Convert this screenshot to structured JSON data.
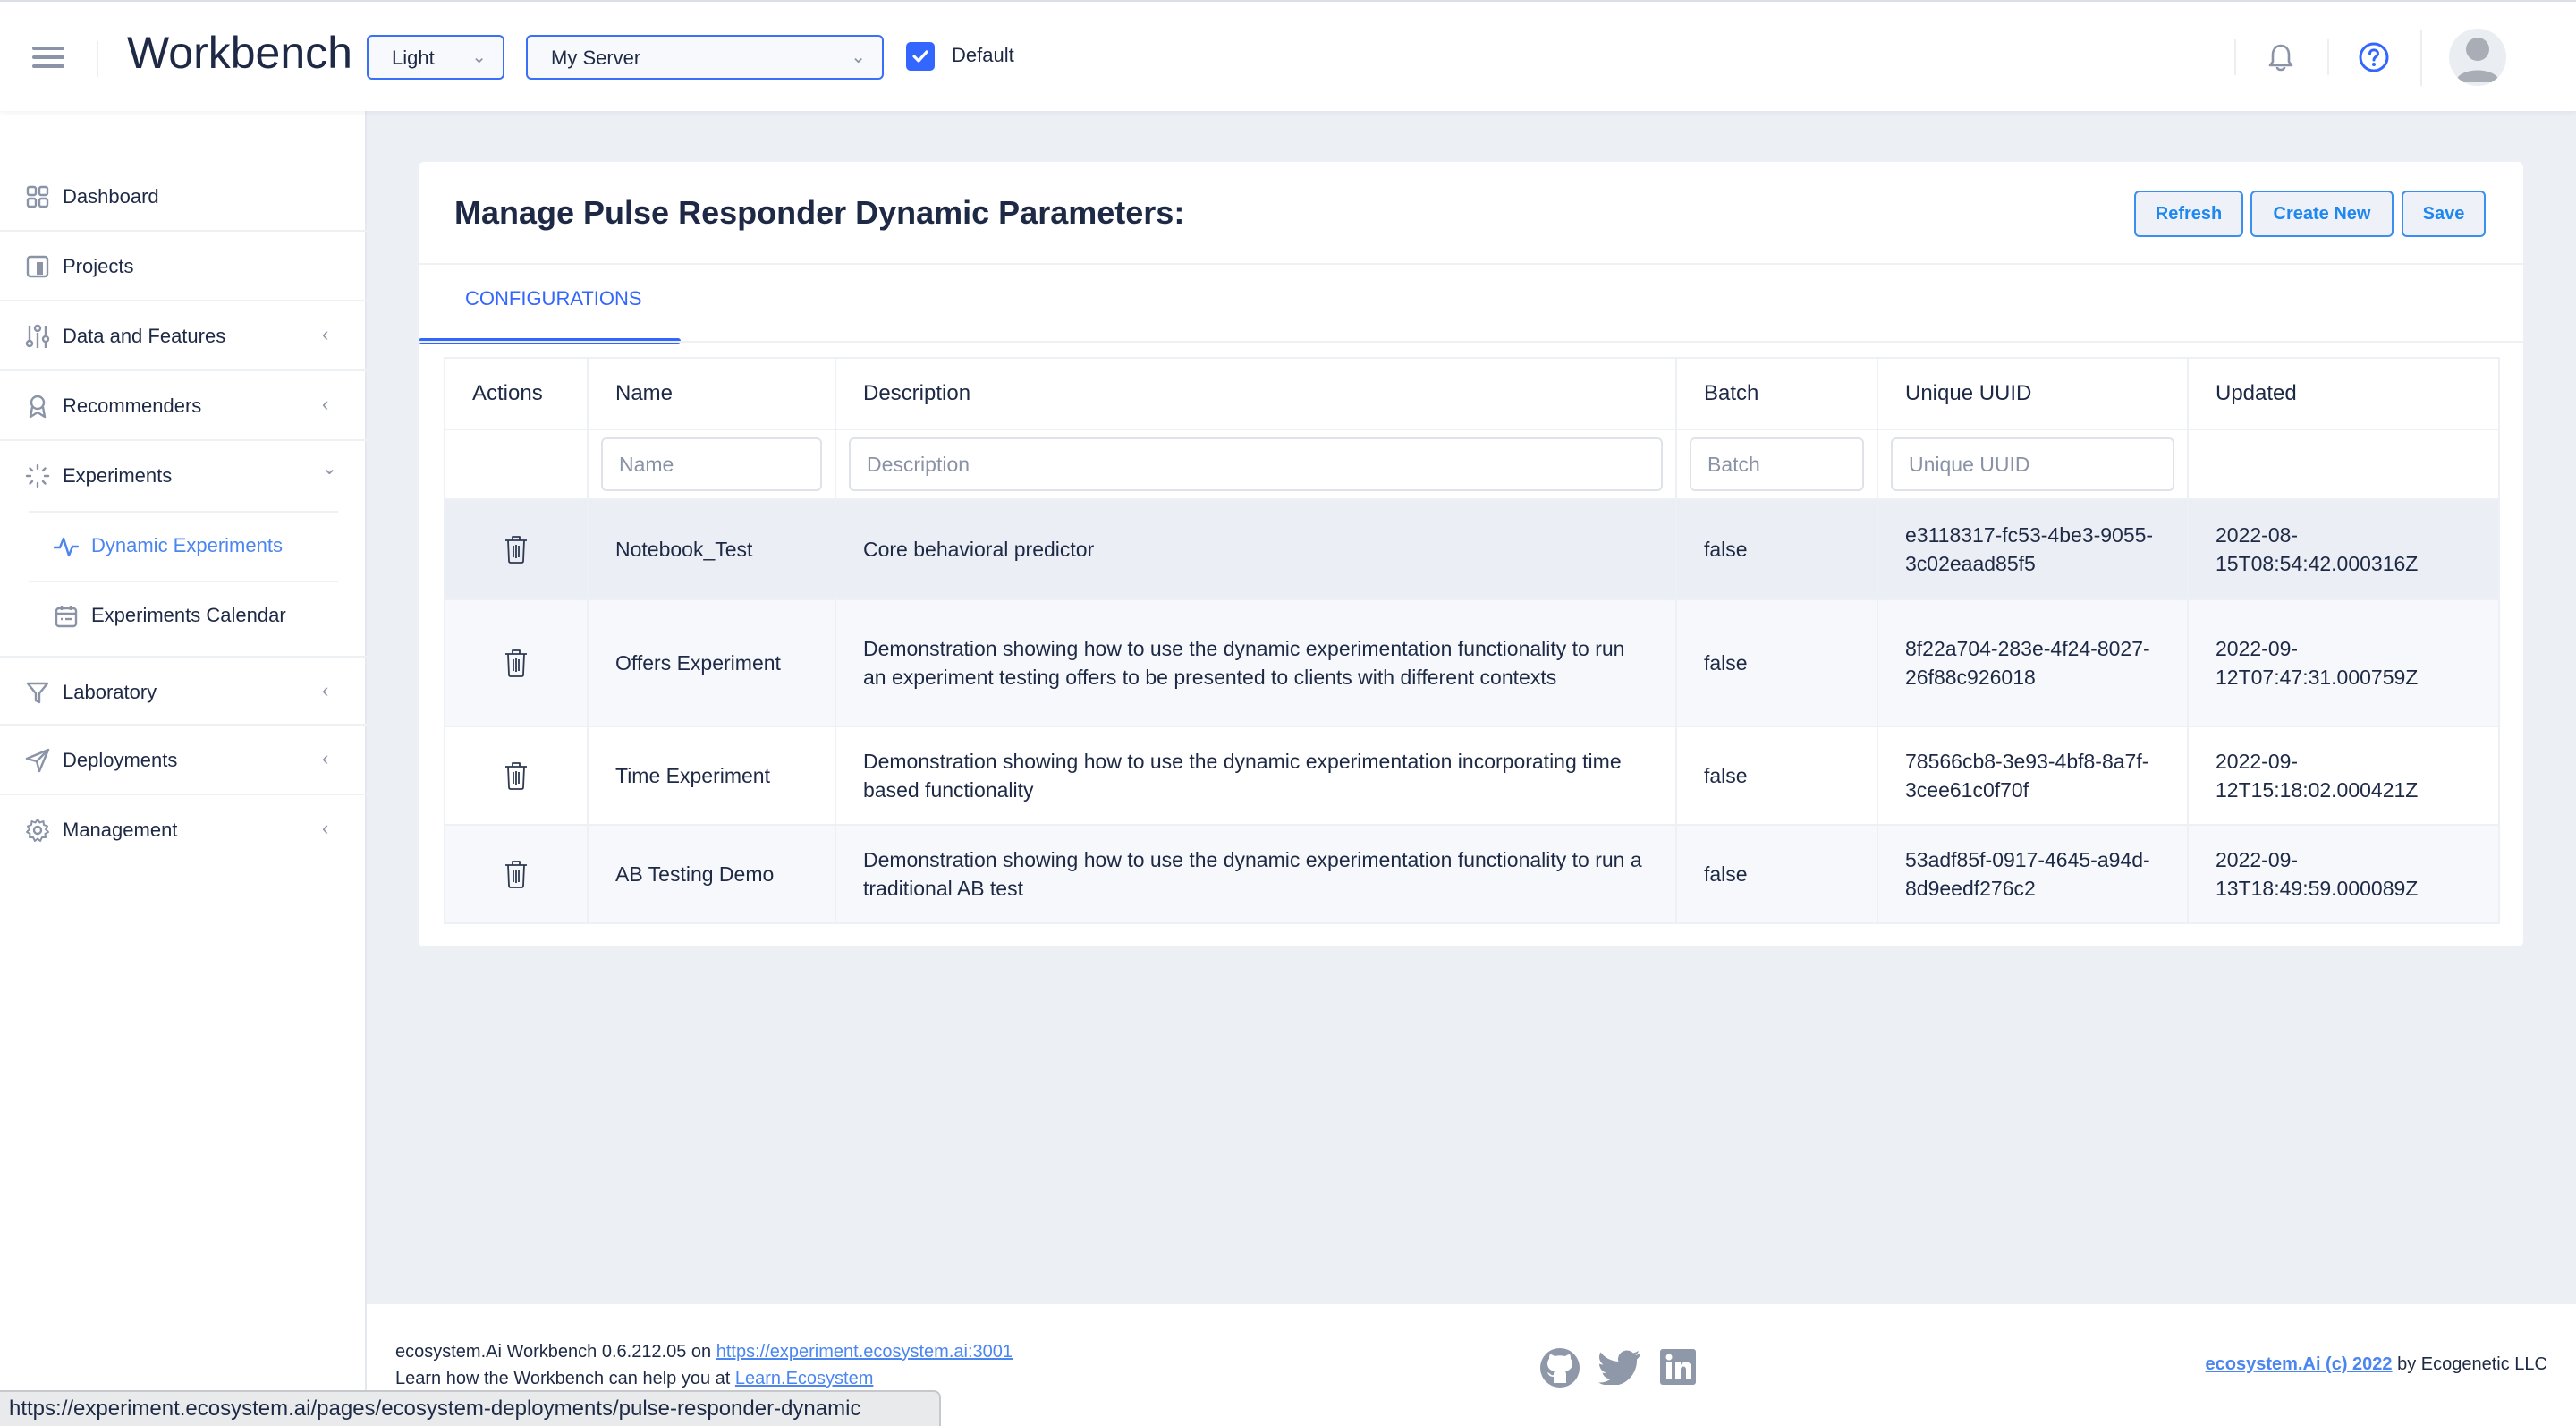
{
  "header": {
    "app_title": "Workbench",
    "theme_select": {
      "value": "Light"
    },
    "server_select": {
      "value": "My Server"
    },
    "default_checkbox": {
      "label": "Default",
      "checked": true
    }
  },
  "sidebar": {
    "items": [
      {
        "label": "Dashboard",
        "icon": "dashboard-grid-icon",
        "expandable": false
      },
      {
        "label": "Projects",
        "icon": "projects-icon",
        "expandable": false
      },
      {
        "label": "Data and Features",
        "icon": "sliders-icon",
        "expandable": true,
        "expanded": false
      },
      {
        "label": "Recommenders",
        "icon": "award-icon",
        "expandable": true,
        "expanded": false
      },
      {
        "label": "Experiments",
        "icon": "loader-icon",
        "expandable": true,
        "expanded": true,
        "children": [
          {
            "label": "Dynamic Experiments",
            "icon": "activity-icon",
            "active": true
          },
          {
            "label": "Experiments Calendar",
            "icon": "calendar-icon",
            "active": false
          }
        ]
      },
      {
        "label": "Laboratory",
        "icon": "filter-icon",
        "expandable": true,
        "expanded": false
      },
      {
        "label": "Deployments",
        "icon": "send-icon",
        "expandable": true,
        "expanded": false
      },
      {
        "label": "Management",
        "icon": "gear-icon",
        "expandable": true,
        "expanded": false
      }
    ]
  },
  "main": {
    "title": "Manage Pulse Responder Dynamic Parameters:",
    "buttons": {
      "refresh": "Refresh",
      "create_new": "Create New",
      "save": "Save"
    },
    "tabs": [
      {
        "label": "CONFIGURATIONS",
        "active": true
      }
    ],
    "table": {
      "columns": [
        "Actions",
        "Name",
        "Description",
        "Batch",
        "Unique UUID",
        "Updated"
      ],
      "filters": {
        "name_placeholder": "Name",
        "description_placeholder": "Description",
        "batch_placeholder": "Batch",
        "uuid_placeholder": "Unique UUID"
      },
      "rows": [
        {
          "name": "Notebook_Test",
          "description": "Core behavioral predictor",
          "batch": "false",
          "uuid": "e3118317-fc53-4be3-9055-3c02eaad85f5",
          "updated": "2022-08-15T08:54:42.000316Z"
        },
        {
          "name": "Offers Experiment",
          "description": "Demonstration showing how to use the dynamic experimentation functionality to run an experiment testing offers to be presented to clients with different contexts",
          "batch": "false",
          "uuid": "8f22a704-283e-4f24-8027-26f88c926018",
          "updated": "2022-09-12T07:47:31.000759Z"
        },
        {
          "name": "Time Experiment",
          "description": "Demonstration showing how to use the dynamic experimentation incorporating time based functionality",
          "batch": "false",
          "uuid": "78566cb8-3e93-4bf8-8a7f-3cee61c0f70f",
          "updated": "2022-09-12T15:18:02.000421Z"
        },
        {
          "name": "AB Testing Demo",
          "description": "Demonstration showing how to use the dynamic experimentation functionality to run a traditional AB test",
          "batch": "false",
          "uuid": "53adf85f-0917-4645-a94d-8d9eedf276c2",
          "updated": "2022-09-13T18:49:59.000089Z"
        }
      ]
    }
  },
  "footer": {
    "version_text": "ecosystem.Ai Workbench 0.6.212.05 on ",
    "server_link": "https://experiment.ecosystem.ai:3001",
    "learn_text": "Learn how the Workbench can help you at ",
    "learn_link": "Learn.Ecosystem",
    "copyright_link": "ecosystem.Ai (c) 2022",
    "copyright_suffix": " by Ecogenetic LLC",
    "social": [
      "github-icon",
      "twitter-icon",
      "linkedin-icon"
    ]
  },
  "status_bar": {
    "hover_url": "https://experiment.ecosystem.ai/pages/ecosystem-deployments/pulse-responder-dynamic"
  },
  "colors": {
    "accent": "#3366ff",
    "link": "#4b86f0",
    "button_text": "#1f87f0",
    "text": "#1e2a45",
    "icon_muted": "#8a94a6",
    "page_bg": "#ecf0f5"
  }
}
